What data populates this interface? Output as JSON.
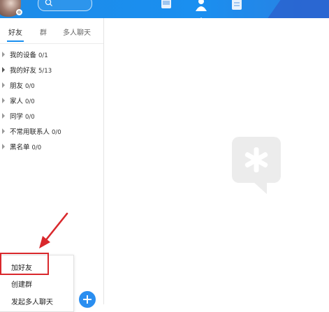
{
  "header": {
    "search": {
      "placeholder": ""
    },
    "icons": [
      "avatar",
      "search-icon",
      "message-icon",
      "contacts-icon",
      "apps-icon"
    ],
    "accent_color": "#1a8ff0"
  },
  "tabs": [
    {
      "label": "好友",
      "active": true
    },
    {
      "label": "群",
      "active": false
    },
    {
      "label": "多人聊天",
      "active": false
    }
  ],
  "groups": [
    {
      "name": "我的设备",
      "count": "0/1"
    },
    {
      "name": "我的好友",
      "count": "5/13"
    },
    {
      "name": "朋友",
      "count": "0/0"
    },
    {
      "name": "家人",
      "count": "0/0"
    },
    {
      "name": "同学",
      "count": "0/0"
    },
    {
      "name": "不常用联系人",
      "count": "0/0"
    },
    {
      "name": "黑名单",
      "count": "0/0"
    }
  ],
  "menu": {
    "items": [
      {
        "label": "加好友"
      },
      {
        "label": "创建群"
      },
      {
        "label": "发起多人聊天"
      }
    ]
  },
  "annotation_color": "#d9282c"
}
